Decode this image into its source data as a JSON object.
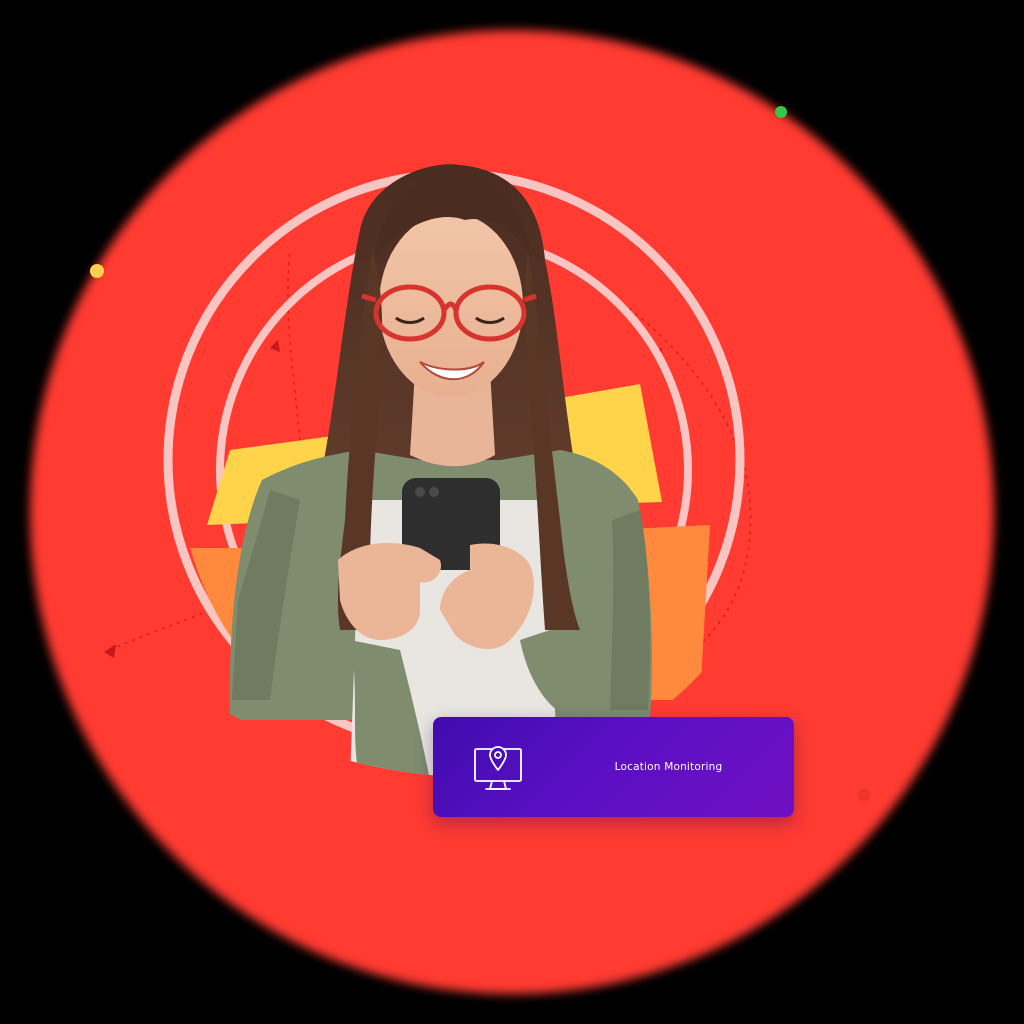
{
  "scene": {
    "colors": {
      "background": "#000000",
      "disc": "#ff3b30",
      "ring": "#f9c5c2",
      "yellow_shape": "#ffd44a",
      "orange_shape": "#ff8a3d",
      "dot_yellow": "#ffcf4d",
      "dot_green": "#35c74a",
      "card_start": "#3f0cae",
      "card_end": "#7010c2"
    },
    "illustration": "person-looking-at-phone"
  },
  "feature_card": {
    "icon": "location-monitor-icon",
    "label": "Location Monitoring"
  }
}
